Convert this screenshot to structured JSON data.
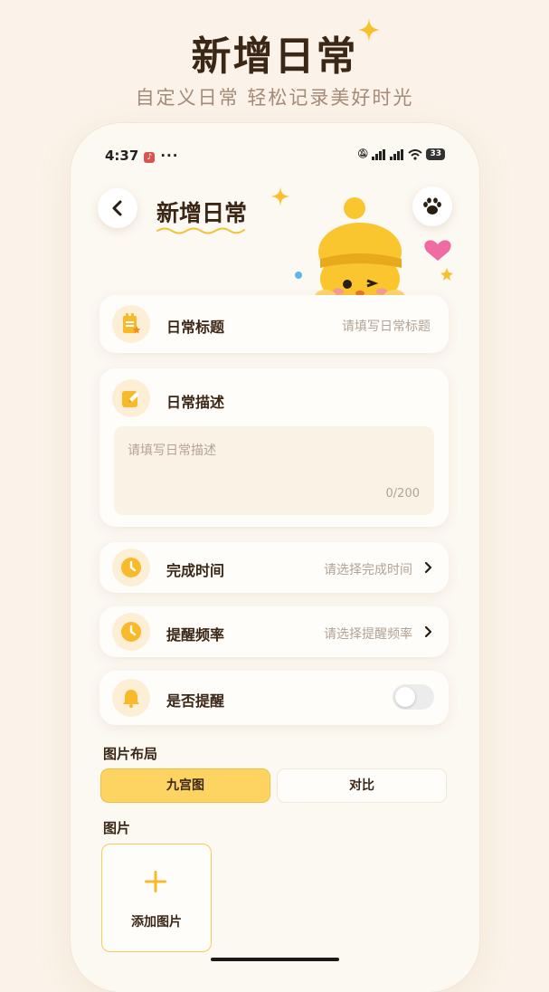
{
  "hero": {
    "title": "新增日常",
    "subtitle": "自定义日常 轻松记录美好时光"
  },
  "status_bar": {
    "time": "4:37",
    "right_signals": "5G 5G",
    "battery": "33"
  },
  "header": {
    "title": "新增日常"
  },
  "form": {
    "title_field": {
      "label": "日常标题",
      "placeholder": "请填写日常标题"
    },
    "description_field": {
      "label": "日常描述",
      "placeholder": "请填写日常描述",
      "counter": "0/200"
    },
    "completion_time": {
      "label": "完成时间",
      "placeholder": "请选择完成时间"
    },
    "reminder_frequency": {
      "label": "提醒频率",
      "placeholder": "请选择提醒频率"
    },
    "reminder_toggle": {
      "label": "是否提醒",
      "enabled": false
    }
  },
  "image_layout": {
    "label": "图片布局",
    "options": [
      "九宫图",
      "对比"
    ],
    "selected": "九宫图"
  },
  "images": {
    "label": "图片",
    "add_label": "添加图片"
  },
  "colors": {
    "accent": "#fdd462",
    "icon_yellow": "#f8b92a",
    "background": "#fbf3e9"
  }
}
